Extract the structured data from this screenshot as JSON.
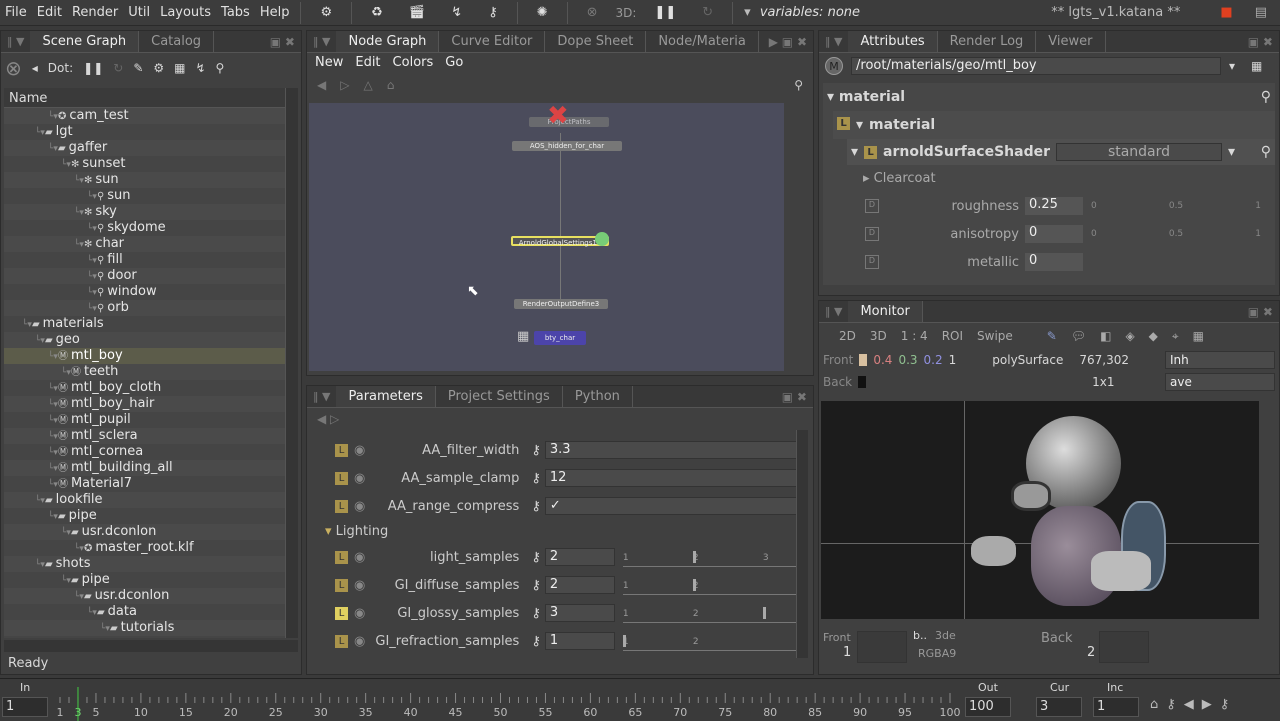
{
  "menu": [
    "File",
    "Edit",
    "Render",
    "Util",
    "Layouts",
    "Tabs",
    "Help"
  ],
  "toolbar": {
    "threeD": "3D:",
    "variables": "variables: none",
    "title": "** lgts_v1.katana **"
  },
  "scene_graph": {
    "tabs": [
      "Scene Graph",
      "Catalog"
    ],
    "toolbar_label": "Dot:",
    "column": "Name",
    "status": "Ready",
    "items": [
      {
        "label": "cam_test",
        "level": 4,
        "icon": "camera"
      },
      {
        "label": "lgt",
        "level": 3,
        "icon": "group"
      },
      {
        "label": "gaffer",
        "level": 4,
        "icon": "group"
      },
      {
        "label": "sunset",
        "level": 5,
        "icon": "rig"
      },
      {
        "label": "sun",
        "level": 6,
        "icon": "rig"
      },
      {
        "label": "sun",
        "level": 7,
        "icon": "light"
      },
      {
        "label": "sky",
        "level": 6,
        "icon": "rig"
      },
      {
        "label": "skydome",
        "level": 7,
        "icon": "light"
      },
      {
        "label": "char",
        "level": 6,
        "icon": "rig"
      },
      {
        "label": "fill",
        "level": 7,
        "icon": "light"
      },
      {
        "label": "door",
        "level": 7,
        "icon": "light"
      },
      {
        "label": "window",
        "level": 7,
        "icon": "light"
      },
      {
        "label": "orb",
        "level": 7,
        "icon": "light"
      },
      {
        "label": "materials",
        "level": 2,
        "icon": "group"
      },
      {
        "label": "geo",
        "level": 3,
        "icon": "group"
      },
      {
        "label": "mtl_boy",
        "level": 4,
        "icon": "material",
        "selected": true
      },
      {
        "label": "teeth",
        "level": 5,
        "icon": "material"
      },
      {
        "label": "mtl_boy_cloth",
        "level": 4,
        "icon": "material"
      },
      {
        "label": "mtl_boy_hair",
        "level": 4,
        "icon": "material"
      },
      {
        "label": "mtl_pupil",
        "level": 4,
        "icon": "material"
      },
      {
        "label": "mtl_sclera",
        "level": 4,
        "icon": "material"
      },
      {
        "label": "mtl_cornea",
        "level": 4,
        "icon": "material"
      },
      {
        "label": "mtl_building_all",
        "level": 4,
        "icon": "material"
      },
      {
        "label": "Material7",
        "level": 4,
        "icon": "material"
      },
      {
        "label": "lookfile",
        "level": 3,
        "icon": "group"
      },
      {
        "label": "pipe",
        "level": 4,
        "icon": "group"
      },
      {
        "label": "usr.dconlon",
        "level": 5,
        "icon": "group"
      },
      {
        "label": "master_root.klf",
        "level": 6,
        "icon": "camera"
      },
      {
        "label": "shots",
        "level": 3,
        "icon": "group"
      },
      {
        "label": "pipe",
        "level": 5,
        "icon": "group"
      },
      {
        "label": "usr.dconlon",
        "level": 6,
        "icon": "group"
      },
      {
        "label": "data",
        "level": 7,
        "icon": "group"
      },
      {
        "label": "tutorials",
        "level": 8,
        "icon": "group"
      }
    ]
  },
  "node_graph": {
    "tabs": [
      "Node Graph",
      "Curve Editor",
      "Dope Sheet",
      "Node/Materia"
    ],
    "menu": [
      "New",
      "Edit",
      "Colors",
      "Go"
    ],
    "nodes": [
      "ProjectPaths",
      "AOS_hidden_for_char",
      "ArnoldGlobalSettings16",
      "RenderOutputDefine3",
      "bty_char"
    ]
  },
  "parameters": {
    "tabs": [
      "Parameters",
      "Project Settings",
      "Python"
    ],
    "rows": [
      {
        "name": "AA_filter_width",
        "value": "3.3"
      },
      {
        "name": "AA_sample_clamp",
        "value": "12"
      },
      {
        "name": "AA_range_compress",
        "value": "✓"
      }
    ],
    "group": "Lighting",
    "lighting": [
      {
        "name": "light_samples",
        "value": "2",
        "ticks": [
          "1",
          "2",
          "3"
        ],
        "level": 2
      },
      {
        "name": "GI_diffuse_samples",
        "value": "2",
        "ticks": [
          "1",
          "2"
        ],
        "level": 2
      },
      {
        "name": "GI_glossy_samples",
        "value": "3",
        "ticks": [
          "1",
          "2"
        ],
        "level": 3
      },
      {
        "name": "GI_refraction_samples",
        "value": "1",
        "ticks": [
          "1",
          "2"
        ],
        "level": 1
      }
    ]
  },
  "attributes": {
    "tabs": [
      "Attributes",
      "Render Log",
      "Viewer"
    ],
    "path": "/root/materials/geo/mtl_boy",
    "section": "material",
    "sub": "material",
    "shader": "arnoldSurfaceShader",
    "shader_type": "standard",
    "group": "Clearcoat",
    "params": [
      {
        "name": "roughness",
        "value": "0.25",
        "ticks": [
          "0",
          "0.5",
          "1"
        ]
      },
      {
        "name": "anisotropy",
        "value": "0",
        "ticks": [
          "0",
          "0.5",
          "1"
        ]
      },
      {
        "name": "metallic",
        "value": "0",
        "ticks": []
      }
    ]
  },
  "monitor": {
    "tab": "Monitor",
    "toolbar": [
      "2D",
      "3D",
      "1 : 4",
      "ROI",
      "Swipe"
    ],
    "front_label": "Front",
    "back_label": "Back",
    "rgba": [
      "0.4",
      "0.3",
      "0.2",
      "1"
    ],
    "object": "polySurface",
    "coords": "767,302",
    "res": "1x1",
    "mode1": "Inh",
    "mode2": "ave",
    "footer": {
      "front": "Front",
      "front_n": "1",
      "back": "Back",
      "back_n": "2",
      "b": "b..",
      "threed": "3de",
      "rgba": "RGBA9"
    },
    "colors": {
      "r": "#d88080",
      "g": "#90c090",
      "b": "#9090e0"
    }
  },
  "timeline": {
    "in_label": "In",
    "in": "1",
    "out_label": "Out",
    "out": "100",
    "cur_label": "Cur",
    "cur": "3",
    "inc_label": "Inc",
    "inc": "1",
    "ticks": [
      "1",
      "3",
      "5",
      "10",
      "15",
      "20",
      "25",
      "30",
      "35",
      "40",
      "45",
      "50",
      "55",
      "60",
      "65",
      "70",
      "75",
      "80",
      "85",
      "90",
      "95",
      "100"
    ],
    "current": 3,
    "range": [
      1,
      100
    ]
  }
}
